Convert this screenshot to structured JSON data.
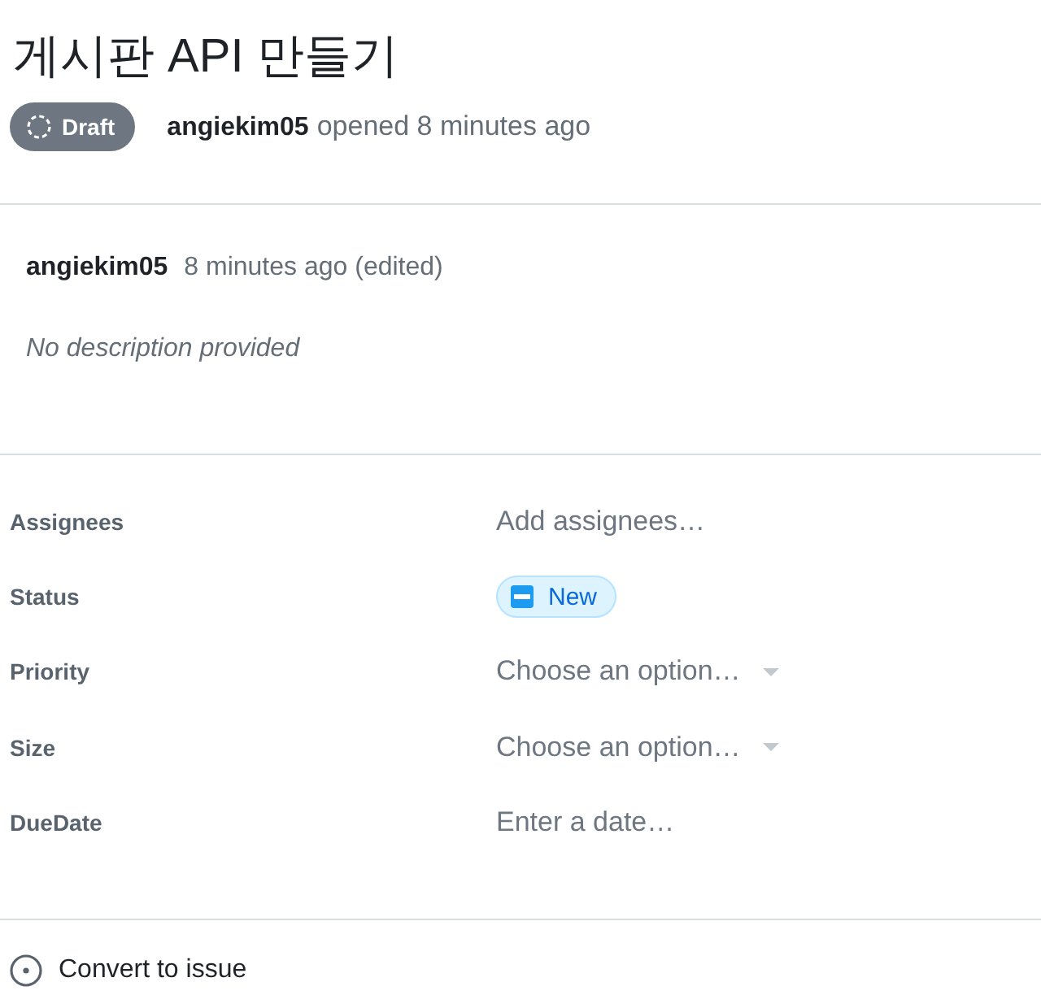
{
  "title": "게시판 API 만들기",
  "header": {
    "state": {
      "kind": "draft",
      "label": "Draft"
    },
    "author": "angiekim05",
    "action": "opened 8 minutes ago"
  },
  "comment": {
    "author": "angiekim05",
    "time": "8 minutes ago (edited)",
    "body": "No description provided"
  },
  "fields": [
    {
      "label": "Assignees",
      "kind": "action",
      "text": "Add assignees…"
    },
    {
      "label": "Status",
      "kind": "status",
      "value": "New"
    },
    {
      "label": "Priority",
      "kind": "select",
      "placeholder": "Choose an option…"
    },
    {
      "label": "Size",
      "kind": "select",
      "placeholder": "Choose an option…"
    },
    {
      "label": "DueDate",
      "kind": "date",
      "placeholder": "Enter a date…"
    }
  ],
  "actions": [
    {
      "kind": "convert",
      "label": "Convert to issue"
    }
  ]
}
